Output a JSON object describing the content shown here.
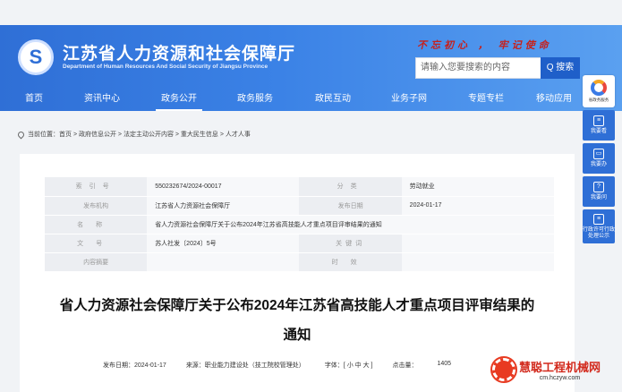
{
  "header": {
    "logo_glyph": "S",
    "title": "江苏省人力资源和社会保障厅",
    "subtitle": "Department of Human Resources And Social Security of Jiangsu Province",
    "slogan": "不忘初心 ， 牢记使命",
    "search_placeholder": "请输入您要搜索的内容",
    "search_button": "Q 搜索"
  },
  "nav": [
    "首页",
    "资讯中心",
    "政务公开",
    "政务服务",
    "政民互动",
    "业务子网",
    "专题专栏",
    "移动应用"
  ],
  "float": {
    "logo_label": "省政务服务",
    "items": [
      {
        "icon": "≡",
        "label": "我要看"
      },
      {
        "icon": "▭",
        "label": "我要办"
      },
      {
        "icon": "?",
        "label": "我要问"
      },
      {
        "icon": "≡",
        "label": "行政许可行政处理公示"
      }
    ]
  },
  "breadcrumb": "当前位置：首页 > 政府信息公开 > 法定主动公开内容 > 重大民生信息 > 人才人事",
  "meta": {
    "index_label": "索引号",
    "index_value": "550232674/2024-00017",
    "category_label": "分类",
    "category_value": "劳动就业",
    "org_label": "发布机构",
    "org_value": "江苏省人力资源社会保障厅",
    "date_label": "发布日期",
    "date_value": "2024-01-17",
    "name_label": "名称",
    "name_value": "省人力资源社会保障厅关于公布2024年江苏省高技能人才重点项目评审结果的通知",
    "doc_label": "文号",
    "doc_value": "苏人社发〔2024〕5号",
    "keyword_label": "关键词",
    "keyword_value": "",
    "summary_label": "内容摘要",
    "summary_value": "",
    "validity_label": "时效",
    "validity_value": ""
  },
  "doc": {
    "title_line1": "省人力资源社会保障厅关于公布2024年江苏省高技能人才重点项目评审结果的",
    "title_line2": "通知",
    "date": "发布日期：2024-01-17",
    "source": "来源：职业能力建设处（技工院校管理处）",
    "font": "字体：[ 小 中 大 ]",
    "views": "点击量：",
    "views_value": "1405"
  },
  "watermark": {
    "big": "慧聪工程机械网",
    "small": "cm.hczyw.com"
  }
}
